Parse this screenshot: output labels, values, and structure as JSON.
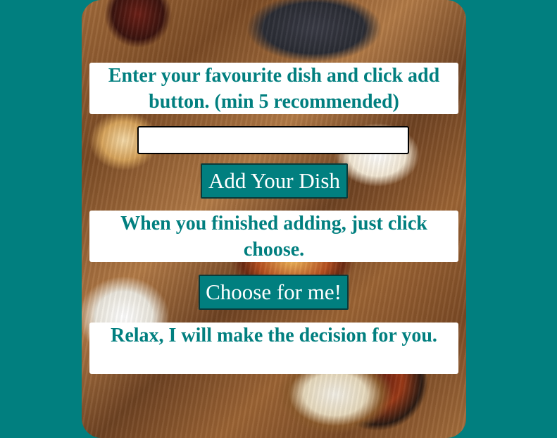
{
  "instructions": {
    "add": "Enter your favourite dish and click add button. (min 5 recommended)",
    "choose": "When you finished adding, just click choose.",
    "result": "Relax, I will make the decision for you."
  },
  "dish_input": {
    "value": "",
    "placeholder": ""
  },
  "buttons": {
    "add_label": "Add Your Dish",
    "choose_label": "Choose for me!"
  },
  "colors": {
    "page_background": "#017f7f",
    "accent": "#017f7f",
    "box_background": "#ffffff"
  }
}
